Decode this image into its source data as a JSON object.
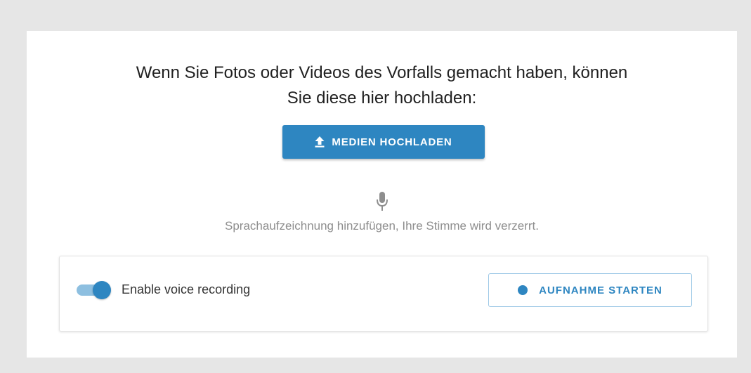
{
  "upload_section": {
    "heading_line1": "Wenn Sie Fotos oder Videos des Vorfalls gemacht haben, können",
    "heading_line2": "Sie diese hier hochladen:",
    "upload_button_label": "MEDIEN HOCHLADEN",
    "upload_icon": "upload-arrow-icon"
  },
  "voice_section": {
    "mic_icon": "microphone-icon",
    "hint": "Sprachaufzeichnung hinzufügen, Ihre Stimme wird verzerrt.",
    "toggle_label": "Enable voice recording",
    "toggle_on": true,
    "record_button_label": "AUFNAHME STARTEN",
    "record_icon": "record-dot-icon"
  },
  "colors": {
    "accent": "#2e86c1",
    "toggle_track": "#8dbfe0",
    "hint_text": "#8e8e8e",
    "page_background": "#e6e6e6"
  }
}
